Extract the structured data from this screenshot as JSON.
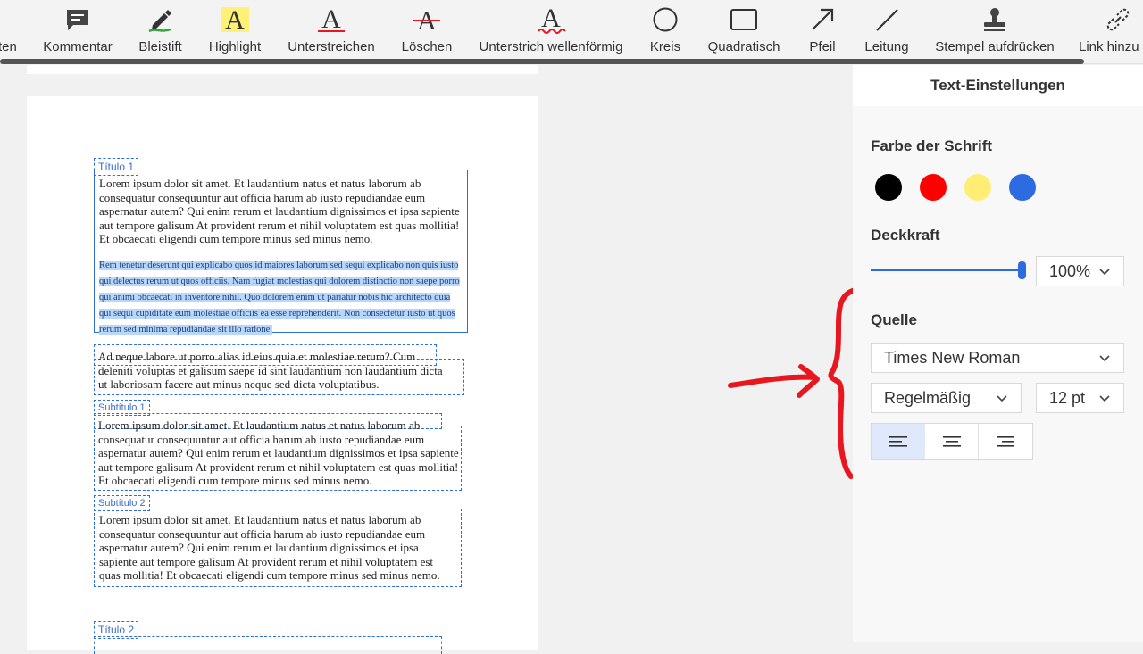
{
  "toolbar": {
    "partial_left": "ten",
    "kommentar": "Kommentar",
    "bleistift": "Bleistift",
    "highlight": "Highlight",
    "unterstreichen": "Unterstreichen",
    "loeschen": "Löschen",
    "wellen": "Unterstrich wellenförmig",
    "kreis": "Kreis",
    "quadratisch": "Quadratisch",
    "pfeil": "Pfeil",
    "leitung": "Leitung",
    "stempel": "Stempel aufdrücken",
    "link": "Link hinzu"
  },
  "icons": {
    "comment": "comment-icon",
    "pencil": "pencil-icon",
    "highlight": "highlight-icon",
    "underline": "underline-icon",
    "strike": "strikethrough-icon",
    "squiggly": "squiggly-underline-icon",
    "circle": "circle-icon",
    "square": "square-icon",
    "arrow": "arrow-icon",
    "line": "line-icon",
    "stamp": "stamp-icon",
    "link": "link-icon"
  },
  "colors": {
    "accent": "#2d6ce0",
    "selection": "#b9d6fb",
    "swatch_black": "#000000",
    "swatch_red": "#ff0000",
    "swatch_yellow": "#ffed74",
    "swatch_blue": "#2d6ce0",
    "annotation": "#e8161e"
  },
  "document": {
    "titulo1": "Título 1",
    "para1": "Lorem ipsum dolor sit amet. Et laudantium natus et natus laborum ab consequatur consequuntur aut officia harum ab iusto repudiandae eum aspernatur autem? Qui enim rerum et laudantium dignissimos et ipsa sapiente aut tempore galisum At provident rerum et nihil voluptatem est quas mollitia! Et obcaecati eligendi cum tempore minus sed minus nemo.",
    "para1_selected": "Rem tenetur deserunt qui explicabo quos id maiores laborum sed sequi explicabo non quis iusto qui delectus rerum ut quos officiis. Nam fugiat molestias qui dolorem distinctio non saepe porro qui animi obcaecati in inventore nihil. Quo dolorem enim ut pariatur nobis hic architecto quia qui sequi cupiditate eum molestiae officiis ea esse reprehenderit. Non consectetur iusto ut quos rerum sed minima repudiandae sit illo ratione.",
    "para2_line1": "Ad neque labore ut porro alias id eius quia et molestiae rerum? Cum",
    "para2_line2": "deleniti voluptas et galisum saepe id sint laudantium non laudantium dicta",
    "para2_line3": "ut laboriosam facere aut minus neque sed dicta voluptatibus.",
    "subtitulo1": "Subtítulo 1",
    "para3_line1": "Lorem ipsum dolor sit amet. Et laudantium natus et natus laborum ab",
    "para3_line2": "consequatur consequuntur aut officia harum ab iusto repudiandae eum",
    "para3_rest": "aspernatur autem? Qui enim rerum et laudantium dignissimos et ipsa sapiente aut tempore galisum At provident rerum et nihil voluptatem est quas mollitia! Et obcaecati eligendi cum tempore minus sed minus nemo.",
    "subtitulo2": "Subtítulo 2",
    "para4": "Lorem ipsum dolor sit amet. Et laudantium natus et natus laborum ab consequatur consequuntur aut officia harum ab iusto repudiandae eum aspernatur autem? Qui enim rerum et laudantium dignissimos et ipsa sapiente aut tempore galisum At provident rerum et nihil voluptatem est quas mollitia! Et obcaecati eligendi cum tempore minus sed minus nemo.",
    "titulo2": "Título 2"
  },
  "panel": {
    "title": "Text-Einstellungen",
    "font_color_label": "Farbe der Schrift",
    "opacity_label": "Deckkraft",
    "opacity_value": "100%",
    "opacity_level": 1.0,
    "source_label": "Quelle",
    "font_family": "Times New Roman",
    "font_style": "Regelmäßig",
    "font_size": "12 pt"
  }
}
